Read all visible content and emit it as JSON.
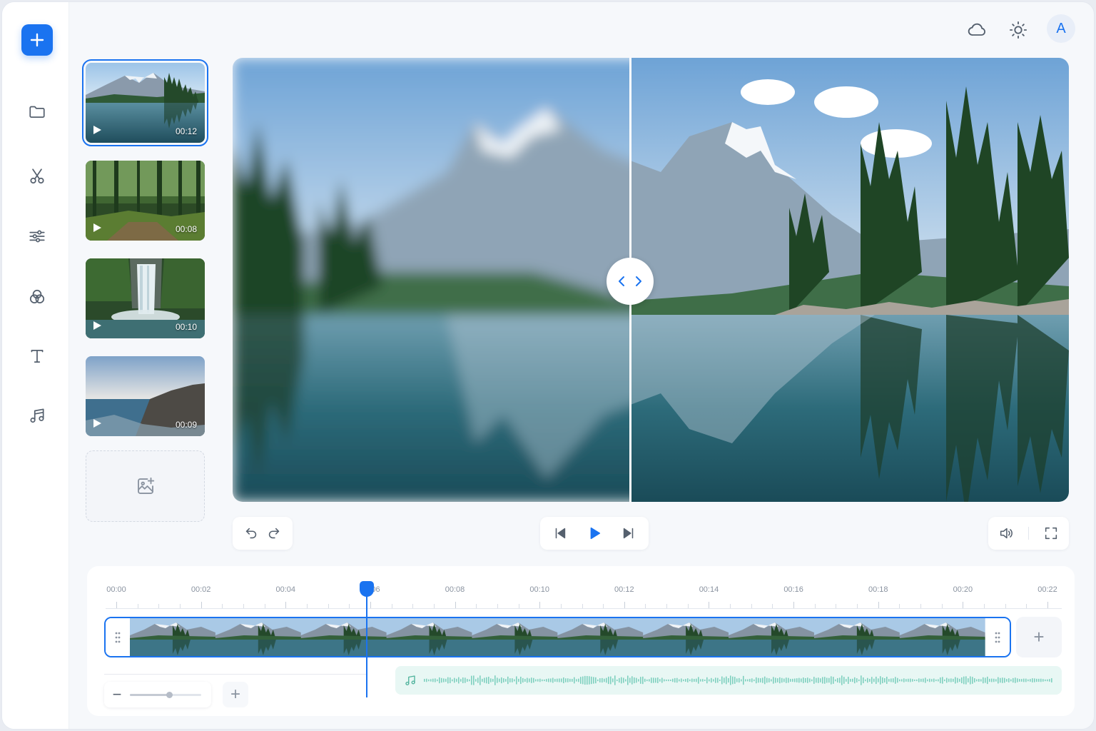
{
  "sidebar": {
    "add_button": "new-project",
    "items": [
      {
        "icon": "folder-icon"
      },
      {
        "icon": "scissors-icon"
      },
      {
        "icon": "sliders-icon"
      },
      {
        "icon": "color-circles-icon"
      },
      {
        "icon": "text-icon"
      },
      {
        "icon": "music-note-icon"
      }
    ]
  },
  "topbar": {
    "icons": [
      "cloud-icon",
      "sun-icon"
    ],
    "avatar_initial": "A"
  },
  "media": {
    "clips": [
      {
        "duration": "00:12",
        "scene": "mountain-lake",
        "selected": true
      },
      {
        "duration": "00:08",
        "scene": "forest"
      },
      {
        "duration": "00:10",
        "scene": "waterfall"
      },
      {
        "duration": "00:09",
        "scene": "coast"
      }
    ],
    "add_icon": "add-image-icon"
  },
  "preview": {
    "mode": "before-after-compare",
    "split_fraction": 0.475
  },
  "controls": {
    "history": [
      "undo-icon",
      "redo-icon"
    ],
    "transport": [
      "skip-back-icon",
      "play-icon",
      "skip-forward-icon"
    ],
    "view": [
      "volume-icon",
      "fullscreen-icon"
    ]
  },
  "timeline": {
    "ticks": [
      "00:00",
      "00:02",
      "00:04",
      "00:06",
      "00:08",
      "00:10",
      "00:12",
      "00:14",
      "00:16",
      "00:18",
      "00:20",
      "00:22"
    ],
    "playhead_time": "00:05.4",
    "add_label": "+",
    "zoom_level": 0.55,
    "zoom_plus": "+",
    "zoom_minus": "−"
  },
  "colors": {
    "accent": "#1a73f0",
    "audio_wave": "#7fd0bf"
  }
}
